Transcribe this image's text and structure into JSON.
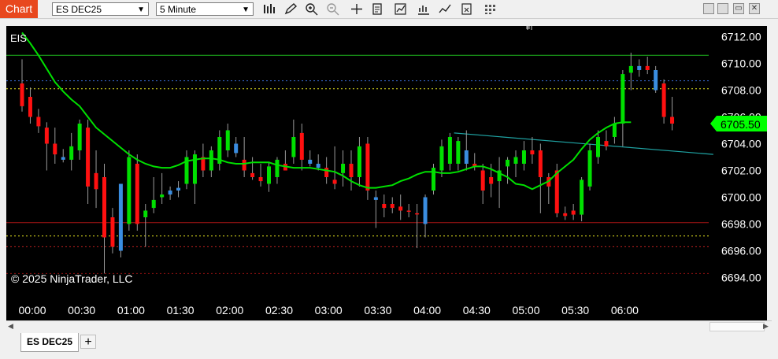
{
  "toolbar": {
    "chart_tab": "Chart",
    "instrument_value": "ES DEC25",
    "interval_value": "5 Minute",
    "icons": [
      "bar-style-icon",
      "pencil-icon",
      "zoom-in-icon",
      "zoom-out-icon",
      "crosshair-icon",
      "data-box-icon",
      "indicators-icon",
      "strategies-icon",
      "chart-trader-icon",
      "properties-icon",
      "grid-icon"
    ],
    "window_buttons": [
      "minimize-icon",
      "restore-icon",
      "maximize-icon",
      "close-icon"
    ]
  },
  "chart": {
    "instrument_label": "EIS",
    "copyright": "© 2025 NinjaTrader, LLC",
    "price_badge": "6705.50"
  },
  "bottom": {
    "instrument_tab": "ES DEC25",
    "add_tab": "+"
  },
  "colors": {
    "up_candle": "#00e000",
    "down_candle": "#ff1010",
    "flat_candle": "#3a8de0",
    "ma_line": "#00e000",
    "trendline": "#1fa3a3",
    "background": "#000000"
  },
  "chart_data": {
    "type": "candlestick",
    "title": "",
    "xlabel": "",
    "ylabel": "",
    "ylim": [
      6693,
      6713.5
    ],
    "y_ticks": [
      "6712.00",
      "6710.00",
      "6708.00",
      "6706.00",
      "6704.00",
      "6702.00",
      "6700.00",
      "6698.00",
      "6696.00",
      "6694.00"
    ],
    "x_ticks": [
      "00:00",
      "00:30",
      "01:00",
      "01:30",
      "02:00",
      "02:30",
      "03:00",
      "03:30",
      "04:00",
      "04:30",
      "05:00",
      "05:30",
      "06:00"
    ],
    "last_price": 6705.5,
    "candles": [
      {
        "o": 6708.5,
        "h": 6710.3,
        "l": 6706.4,
        "c": 6706.8,
        "t": "down"
      },
      {
        "o": 6707.5,
        "h": 6708.2,
        "l": 6705.5,
        "c": 6706.0,
        "t": "down"
      },
      {
        "o": 6706.0,
        "h": 6706.6,
        "l": 6704.8,
        "c": 6705.3,
        "t": "down"
      },
      {
        "o": 6705.2,
        "h": 6705.6,
        "l": 6702.0,
        "c": 6704.0,
        "t": "down"
      },
      {
        "o": 6704.0,
        "h": 6705.2,
        "l": 6702.5,
        "c": 6703.2,
        "t": "down"
      },
      {
        "o": 6703.0,
        "h": 6703.6,
        "l": 6702.6,
        "c": 6702.8,
        "t": "flat"
      },
      {
        "o": 6702.8,
        "h": 6704.8,
        "l": 6702.0,
        "c": 6703.8,
        "t": "up"
      },
      {
        "o": 6703.5,
        "h": 6705.8,
        "l": 6702.8,
        "c": 6705.5,
        "t": "up"
      },
      {
        "o": 6705.2,
        "h": 6705.8,
        "l": 6699.5,
        "c": 6700.8,
        "t": "down"
      },
      {
        "o": 6701.8,
        "h": 6703.5,
        "l": 6699.2,
        "c": 6700.6,
        "t": "down"
      },
      {
        "o": 6701.5,
        "h": 6702.5,
        "l": 6694.3,
        "c": 6697.0,
        "t": "down"
      },
      {
        "o": 6698.5,
        "h": 6699.2,
        "l": 6695.8,
        "c": 6696.3,
        "t": "down"
      },
      {
        "o": 6696.0,
        "h": 6700.5,
        "l": 6695.5,
        "c": 6701.0,
        "t": "flat"
      },
      {
        "o": 6698.0,
        "h": 6703.5,
        "l": 6697.5,
        "c": 6703.0,
        "t": "up"
      },
      {
        "o": 6702.5,
        "h": 6703.2,
        "l": 6697.5,
        "c": 6698.0,
        "t": "down"
      },
      {
        "o": 6698.5,
        "h": 6699.5,
        "l": 6696.3,
        "c": 6699.0,
        "t": "up"
      },
      {
        "o": 6699.2,
        "h": 6701.5,
        "l": 6698.8,
        "c": 6699.8,
        "t": "up"
      },
      {
        "o": 6700.0,
        "h": 6701.8,
        "l": 6699.5,
        "c": 6700.2,
        "t": "up"
      },
      {
        "o": 6700.2,
        "h": 6700.8,
        "l": 6699.8,
        "c": 6700.5,
        "t": "flat"
      },
      {
        "o": 6700.5,
        "h": 6701.2,
        "l": 6700.0,
        "c": 6700.7,
        "t": "flat"
      },
      {
        "o": 6701.0,
        "h": 6703.5,
        "l": 6700.6,
        "c": 6703.0,
        "t": "up"
      },
      {
        "o": 6701.0,
        "h": 6703.5,
        "l": 6699.5,
        "c": 6703.2,
        "t": "up"
      },
      {
        "o": 6703.0,
        "h": 6704.0,
        "l": 6701.5,
        "c": 6702.0,
        "t": "down"
      },
      {
        "o": 6702.0,
        "h": 6703.8,
        "l": 6701.5,
        "c": 6703.5,
        "t": "up"
      },
      {
        "o": 6702.5,
        "h": 6705.0,
        "l": 6702.0,
        "c": 6704.5,
        "t": "up"
      },
      {
        "o": 6703.5,
        "h": 6705.5,
        "l": 6703.0,
        "c": 6705.0,
        "t": "up"
      },
      {
        "o": 6704.0,
        "h": 6704.5,
        "l": 6703.0,
        "c": 6703.3,
        "t": "flat"
      },
      {
        "o": 6702.8,
        "h": 6704.5,
        "l": 6701.5,
        "c": 6702.0,
        "t": "down"
      },
      {
        "o": 6701.8,
        "h": 6703.0,
        "l": 6701.3,
        "c": 6701.5,
        "t": "down"
      },
      {
        "o": 6701.5,
        "h": 6702.5,
        "l": 6700.8,
        "c": 6701.2,
        "t": "down"
      },
      {
        "o": 6701.0,
        "h": 6702.6,
        "l": 6700.4,
        "c": 6702.3,
        "t": "up"
      },
      {
        "o": 6701.5,
        "h": 6703.0,
        "l": 6701.0,
        "c": 6702.8,
        "t": "up"
      },
      {
        "o": 6702.5,
        "h": 6703.5,
        "l": 6702.0,
        "c": 6702.0,
        "t": "down"
      },
      {
        "o": 6703.0,
        "h": 6705.8,
        "l": 6702.5,
        "c": 6704.5,
        "t": "up"
      },
      {
        "o": 6704.8,
        "h": 6705.5,
        "l": 6702.0,
        "c": 6702.8,
        "t": "down"
      },
      {
        "o": 6702.8,
        "h": 6703.5,
        "l": 6702.3,
        "c": 6702.5,
        "t": "flat"
      },
      {
        "o": 6702.5,
        "h": 6703.2,
        "l": 6702.0,
        "c": 6702.2,
        "t": "flat"
      },
      {
        "o": 6702.2,
        "h": 6703.0,
        "l": 6701.0,
        "c": 6701.5,
        "t": "down"
      },
      {
        "o": 6701.3,
        "h": 6703.8,
        "l": 6700.6,
        "c": 6701.0,
        "t": "down"
      },
      {
        "o": 6701.8,
        "h": 6703.5,
        "l": 6700.8,
        "c": 6702.5,
        "t": "up"
      },
      {
        "o": 6702.5,
        "h": 6703.5,
        "l": 6700.5,
        "c": 6701.5,
        "t": "down"
      },
      {
        "o": 6701.5,
        "h": 6704.5,
        "l": 6700.8,
        "c": 6703.8,
        "t": "up"
      },
      {
        "o": 6704.0,
        "h": 6704.5,
        "l": 6699.8,
        "c": 6700.5,
        "t": "down"
      },
      {
        "o": 6700.0,
        "h": 6700.5,
        "l": 6697.7,
        "c": 6699.8,
        "t": "flat"
      },
      {
        "o": 6699.5,
        "h": 6700.2,
        "l": 6698.5,
        "c": 6699.2,
        "t": "down"
      },
      {
        "o": 6699.5,
        "h": 6700.0,
        "l": 6698.8,
        "c": 6699.2,
        "t": "down"
      },
      {
        "o": 6699.3,
        "h": 6700.2,
        "l": 6698.3,
        "c": 6699.0,
        "t": "down"
      },
      {
        "o": 6699.0,
        "h": 6699.5,
        "l": 6698.5,
        "c": 6699.0,
        "t": "down"
      },
      {
        "o": 6698.8,
        "h": 6699.5,
        "l": 6696.2,
        "c": 6698.8,
        "t": "down"
      },
      {
        "o": 6698.0,
        "h": 6700.2,
        "l": 6697.0,
        "c": 6700.0,
        "t": "flat"
      },
      {
        "o": 6700.5,
        "h": 6702.5,
        "l": 6700.2,
        "c": 6702.2,
        "t": "up"
      },
      {
        "o": 6702.0,
        "h": 6704.3,
        "l": 6701.5,
        "c": 6703.8,
        "t": "up"
      },
      {
        "o": 6702.5,
        "h": 6704.8,
        "l": 6702.0,
        "c": 6704.5,
        "t": "up"
      },
      {
        "o": 6702.5,
        "h": 6704.5,
        "l": 6702.0,
        "c": 6704.2,
        "t": "up"
      },
      {
        "o": 6703.5,
        "h": 6705.0,
        "l": 6702.0,
        "c": 6702.5,
        "t": "flat"
      },
      {
        "o": 6702.5,
        "h": 6703.3,
        "l": 6702.0,
        "c": 6702.3,
        "t": "down"
      },
      {
        "o": 6702.0,
        "h": 6702.5,
        "l": 6699.5,
        "c": 6700.5,
        "t": "down"
      },
      {
        "o": 6701.5,
        "h": 6702.5,
        "l": 6700.0,
        "c": 6701.0,
        "t": "down"
      },
      {
        "o": 6701.2,
        "h": 6703.0,
        "l": 6699.2,
        "c": 6702.0,
        "t": "up"
      },
      {
        "o": 6702.3,
        "h": 6703.0,
        "l": 6701.0,
        "c": 6702.8,
        "t": "up"
      },
      {
        "o": 6702.5,
        "h": 6703.5,
        "l": 6701.5,
        "c": 6703.0,
        "t": "up"
      },
      {
        "o": 6702.5,
        "h": 6704.2,
        "l": 6702.0,
        "c": 6703.5,
        "t": "up"
      },
      {
        "o": 6703.5,
        "h": 6704.5,
        "l": 6702.5,
        "c": 6703.2,
        "t": "down"
      },
      {
        "o": 6703.5,
        "h": 6704.0,
        "l": 6698.8,
        "c": 6701.5,
        "t": "down"
      },
      {
        "o": 6701.5,
        "h": 6701.8,
        "l": 6699.5,
        "c": 6700.8,
        "t": "down"
      },
      {
        "o": 6702.0,
        "h": 6702.5,
        "l": 6698.5,
        "c": 6698.8,
        "t": "down"
      },
      {
        "o": 6698.8,
        "h": 6699.3,
        "l": 6698.3,
        "c": 6698.6,
        "t": "down"
      },
      {
        "o": 6699.0,
        "h": 6699.5,
        "l": 6698.3,
        "c": 6698.7,
        "t": "down"
      },
      {
        "o": 6698.7,
        "h": 6701.5,
        "l": 6698.2,
        "c": 6701.3,
        "t": "up"
      },
      {
        "o": 6700.8,
        "h": 6704.0,
        "l": 6700.5,
        "c": 6703.5,
        "t": "up"
      },
      {
        "o": 6703.0,
        "h": 6705.0,
        "l": 6702.5,
        "c": 6704.5,
        "t": "up"
      },
      {
        "o": 6703.8,
        "h": 6705.0,
        "l": 6703.5,
        "c": 6704.2,
        "t": "down"
      },
      {
        "o": 6704.5,
        "h": 6706.0,
        "l": 6704.0,
        "c": 6705.5,
        "t": "up"
      },
      {
        "o": 6705.5,
        "h": 6709.5,
        "l": 6703.8,
        "c": 6709.2,
        "t": "up"
      },
      {
        "o": 6709.3,
        "h": 6710.8,
        "l": 6708.0,
        "c": 6709.8,
        "t": "up"
      },
      {
        "o": 6709.5,
        "h": 6710.3,
        "l": 6709.0,
        "c": 6709.8,
        "t": "flat"
      },
      {
        "o": 6709.8,
        "h": 6710.5,
        "l": 6709.2,
        "c": 6709.5,
        "t": "down"
      },
      {
        "o": 6709.5,
        "h": 6709.8,
        "l": 6707.8,
        "c": 6708.0,
        "t": "flat"
      },
      {
        "o": 6708.5,
        "h": 6708.8,
        "l": 6705.5,
        "c": 6706.0,
        "t": "down"
      },
      {
        "o": 6706.0,
        "h": 6707.5,
        "l": 6705.0,
        "c": 6705.5,
        "t": "down"
      }
    ],
    "moving_average": [
      6712.3,
      6711.5,
      6710.6,
      6709.6,
      6708.6,
      6707.9,
      6707.3,
      6706.8,
      6706.0,
      6705.2,
      6704.7,
      6704.2,
      6703.7,
      6703.2,
      6702.8,
      6702.5,
      6702.3,
      6702.2,
      6702.2,
      6702.4,
      6702.7,
      6702.8,
      6702.9,
      6702.9,
      6702.8,
      6702.6,
      6702.5,
      6702.5,
      6702.6,
      6702.6,
      6702.6,
      6702.4,
      6702.3,
      6702.2,
      6702.2,
      6702.2,
      6702.1,
      6702.0,
      6701.9,
      6701.6,
      6701.2,
      6700.9,
      6700.7,
      6700.7,
      6700.8,
      6700.9,
      6701.2,
      6701.4,
      6701.7,
      6701.9,
      6701.9,
      6701.8,
      6701.8,
      6701.9,
      6702.1,
      6702.3,
      6702.3,
      6702.1,
      6701.8,
      6701.5,
      6701.0,
      6700.9,
      6700.6,
      6700.9,
      6701.2,
      6701.8,
      6702.3,
      6702.8,
      6703.6,
      6704.3,
      6704.8,
      6705.2,
      6705.5,
      6705.6,
      6705.6
    ],
    "horizontal_lines": [
      {
        "price": 6710.6,
        "style": "solid",
        "color": "#1db21d"
      },
      {
        "price": 6708.7,
        "style": "dotted",
        "color": "#3a6bd8"
      },
      {
        "price": 6708.1,
        "style": "dotted",
        "color": "#e8e820"
      },
      {
        "price": 6698.1,
        "style": "solid",
        "color": "#b01515"
      },
      {
        "price": 6697.1,
        "style": "dotted",
        "color": "#e8e820"
      },
      {
        "price": 6696.3,
        "style": "dotted",
        "color": "#c02020"
      },
      {
        "price": 6694.3,
        "style": "dotted",
        "color": "#901010"
      }
    ],
    "trendline": {
      "from": {
        "bar": 52.5,
        "price": 6704.8
      },
      "to": {
        "bar": 84,
        "price": 6703.2
      }
    }
  }
}
